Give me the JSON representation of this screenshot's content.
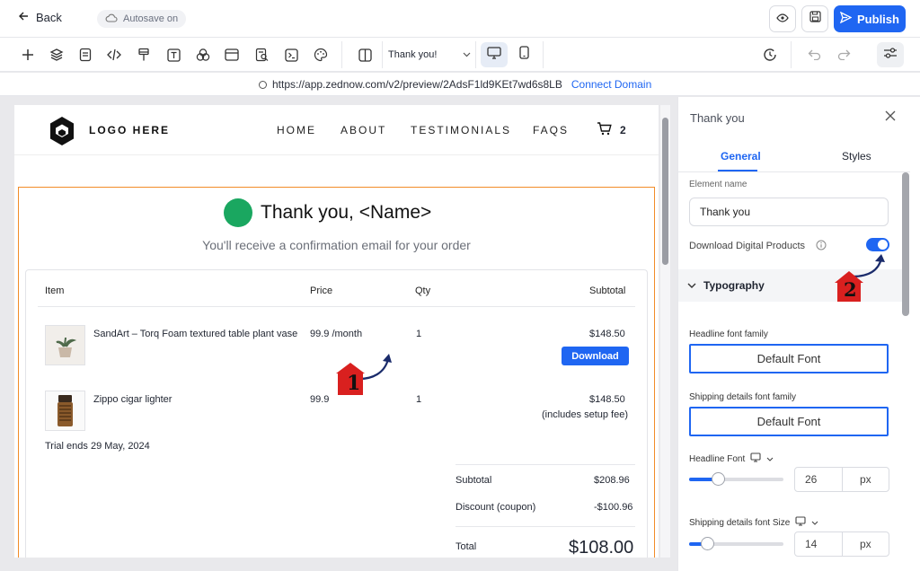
{
  "topbar": {
    "back_label": "Back",
    "autosave_label": "Autosave on",
    "publish_label": "Publish"
  },
  "toolbar": {
    "page_select": "Thank you!"
  },
  "urlbar": {
    "url": "https://app.zednow.com/v2/preview/2AdsF1ld9KEt7wd6s8LB",
    "connect_label": "Connect Domain"
  },
  "site": {
    "logo_text": "LOGO HERE",
    "nav": [
      "HOME",
      "ABOUT",
      "TESTIMONIALS",
      "FAQS"
    ],
    "cart_count": "2"
  },
  "thankyou": {
    "title": "Thank you, <Name>",
    "subtitle": "You'll receive a confirmation email for your order"
  },
  "order": {
    "headers": {
      "item": "Item",
      "price": "Price",
      "qty": "Qty",
      "subtotal": "Subtotal"
    },
    "rows": [
      {
        "name": "SandArt – Torq Foam textured table plant vase",
        "price": "99.9 /month",
        "qty": "1",
        "subtotal": "$148.50",
        "button": "Download"
      },
      {
        "name": "Zippo cigar lighter",
        "price": "99.9",
        "qty": "1",
        "subtotal": "$148.50",
        "note": "(includes setup fee)"
      }
    ],
    "trial": "Trial ends 29 May, 2024",
    "summary": {
      "subtotal_label": "Subtotal",
      "subtotal_value": "$208.96",
      "discount_label": "Discount (coupon)",
      "discount_value": "-$100.96",
      "total_label": "Total",
      "total_value": "$108.00"
    }
  },
  "panel": {
    "title": "Thank you",
    "tabs": [
      "General",
      "Styles"
    ],
    "element_name_label": "Element name",
    "element_name_value": "Thank you",
    "download_label": "Download Digital Products",
    "typography_label": "Typography",
    "headline_family_label": "Headline font family",
    "headline_family_value": "Default Font",
    "shipping_family_label": "Shipping details font family",
    "shipping_family_value": "Default Font",
    "headline_font_label": "Headline Font",
    "headline_font_size": "26",
    "shipping_size_label": "Shipping details font Size",
    "shipping_size_value": "14",
    "unit": "px"
  },
  "annotations": {
    "marker1": "1",
    "marker2": "2"
  },
  "colors": {
    "accent": "#1f66f2",
    "highlight_border": "#f28c28",
    "success": "#1aa760",
    "marker": "#d9201f"
  },
  "toggles": {
    "download_digital_products": true
  }
}
